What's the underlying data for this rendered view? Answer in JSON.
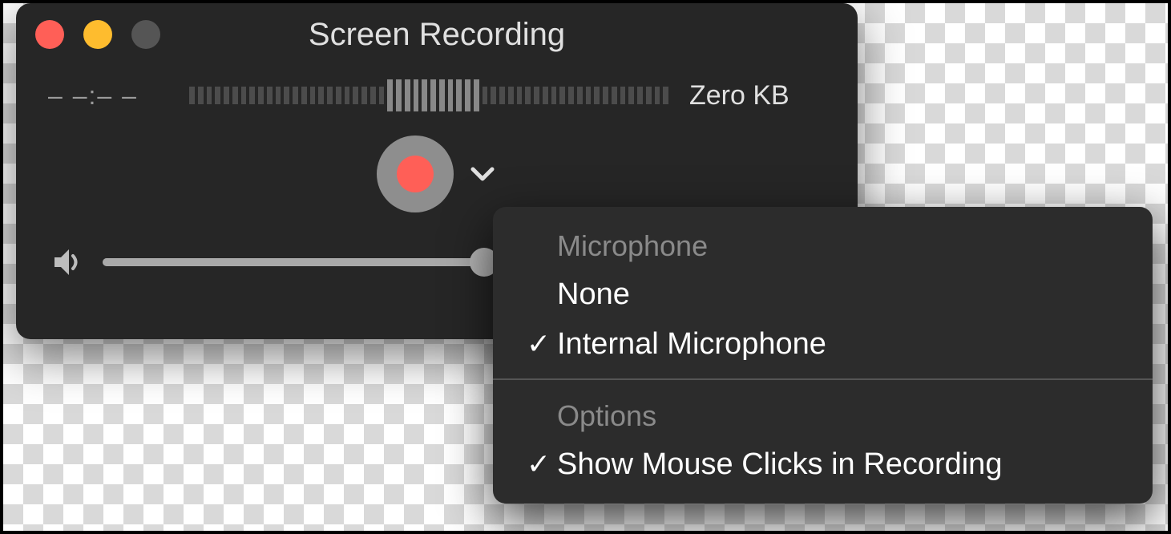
{
  "window": {
    "title": "Screen Recording",
    "time": "– –:– –",
    "filesize": "Zero KB",
    "volume_percent": 53
  },
  "level_meter": {
    "total_ticks": 56,
    "highlight_start": 23,
    "highlight_end": 34
  },
  "menu": {
    "section_mic": "Microphone",
    "items_mic": [
      {
        "label": "None",
        "checked": false
      },
      {
        "label": "Internal Microphone",
        "checked": true
      }
    ],
    "section_opts": "Options",
    "items_opts": [
      {
        "label": "Show Mouse Clicks in Recording",
        "checked": true
      }
    ]
  },
  "glyphs": {
    "check": "✓"
  }
}
